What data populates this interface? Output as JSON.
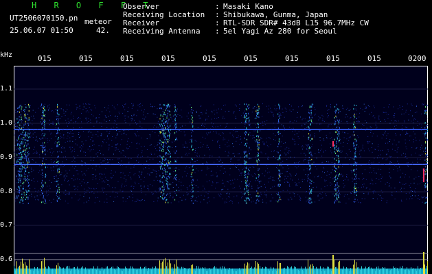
{
  "header": {
    "brand": "H R O F F T",
    "filename": "UT2506070150.pn",
    "mode_label": "meteor",
    "timestamp": "25.06.07 01:50",
    "count": "42.",
    "info": [
      {
        "key": "Observer",
        "value": "Masaki Kano"
      },
      {
        "key": "Receiving Location",
        "value": "Shibukawa, Gunma, Japan"
      },
      {
        "key": "Receiver",
        "value": "RTL-SDR SDR# 43dB L15 96.7MHz CW"
      },
      {
        "key": "Receiving Antenna",
        "value": "5el Yagi Az 280 for Seoul"
      }
    ]
  },
  "axes": {
    "unit": "kHz",
    "y_ticks": [
      "1.1",
      "1.0",
      "0.9",
      "0.8",
      "0.7",
      "0.6"
    ],
    "x_ticks": [
      "015",
      "015",
      "015",
      "015",
      "015",
      "015",
      "015",
      "015",
      "015",
      "0200"
    ]
  },
  "colors": {
    "background": "#000000",
    "plot": "#00001c",
    "brand": "#2fe02f",
    "text": "#ffffff"
  }
}
